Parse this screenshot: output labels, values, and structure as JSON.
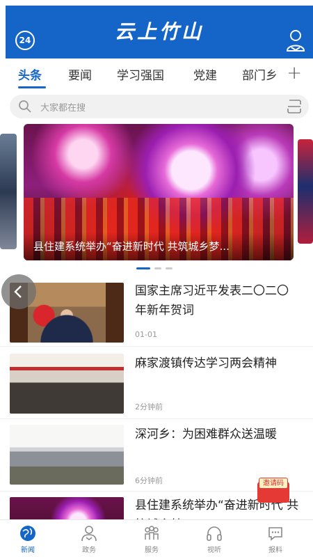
{
  "header": {
    "brand": "云上竹山",
    "weather_badge": "24"
  },
  "tabs": [
    {
      "label": "头条",
      "active": true
    },
    {
      "label": "要闻",
      "active": false
    },
    {
      "label": "学习强国",
      "active": false
    },
    {
      "label": "党建",
      "active": false
    },
    {
      "label": "部门乡",
      "active": false
    }
  ],
  "tabs_add": "+",
  "search": {
    "placeholder": "大家都在搜"
  },
  "banner": {
    "caption": "县住建系统举办“奋进新时代 共筑城乡梦..."
  },
  "news": [
    {
      "title": "国家主席习近平发表二〇二〇年新年贺词",
      "time": "01-01"
    },
    {
      "title": "麻家渡镇传达学习两会精神",
      "time": "2分钟前"
    },
    {
      "title": "深河乡：为困难群众送温暖",
      "time": "6分钟前"
    },
    {
      "title": "县住建系统举办“奋进新时代 共筑城乡梦”",
      "time": ""
    }
  ],
  "invite": {
    "label": "邀请码"
  },
  "bottom_nav": [
    {
      "label": "新闻",
      "icon": "globe-icon",
      "active": true
    },
    {
      "label": "政务",
      "icon": "people-icon",
      "active": false
    },
    {
      "label": "服务",
      "icon": "group-icon",
      "active": false
    },
    {
      "label": "视听",
      "icon": "headphones-icon",
      "active": false
    },
    {
      "label": "报料",
      "icon": "chat-icon",
      "active": false
    }
  ],
  "colors": {
    "accent": "#1565c8",
    "badge": "#e53935"
  }
}
